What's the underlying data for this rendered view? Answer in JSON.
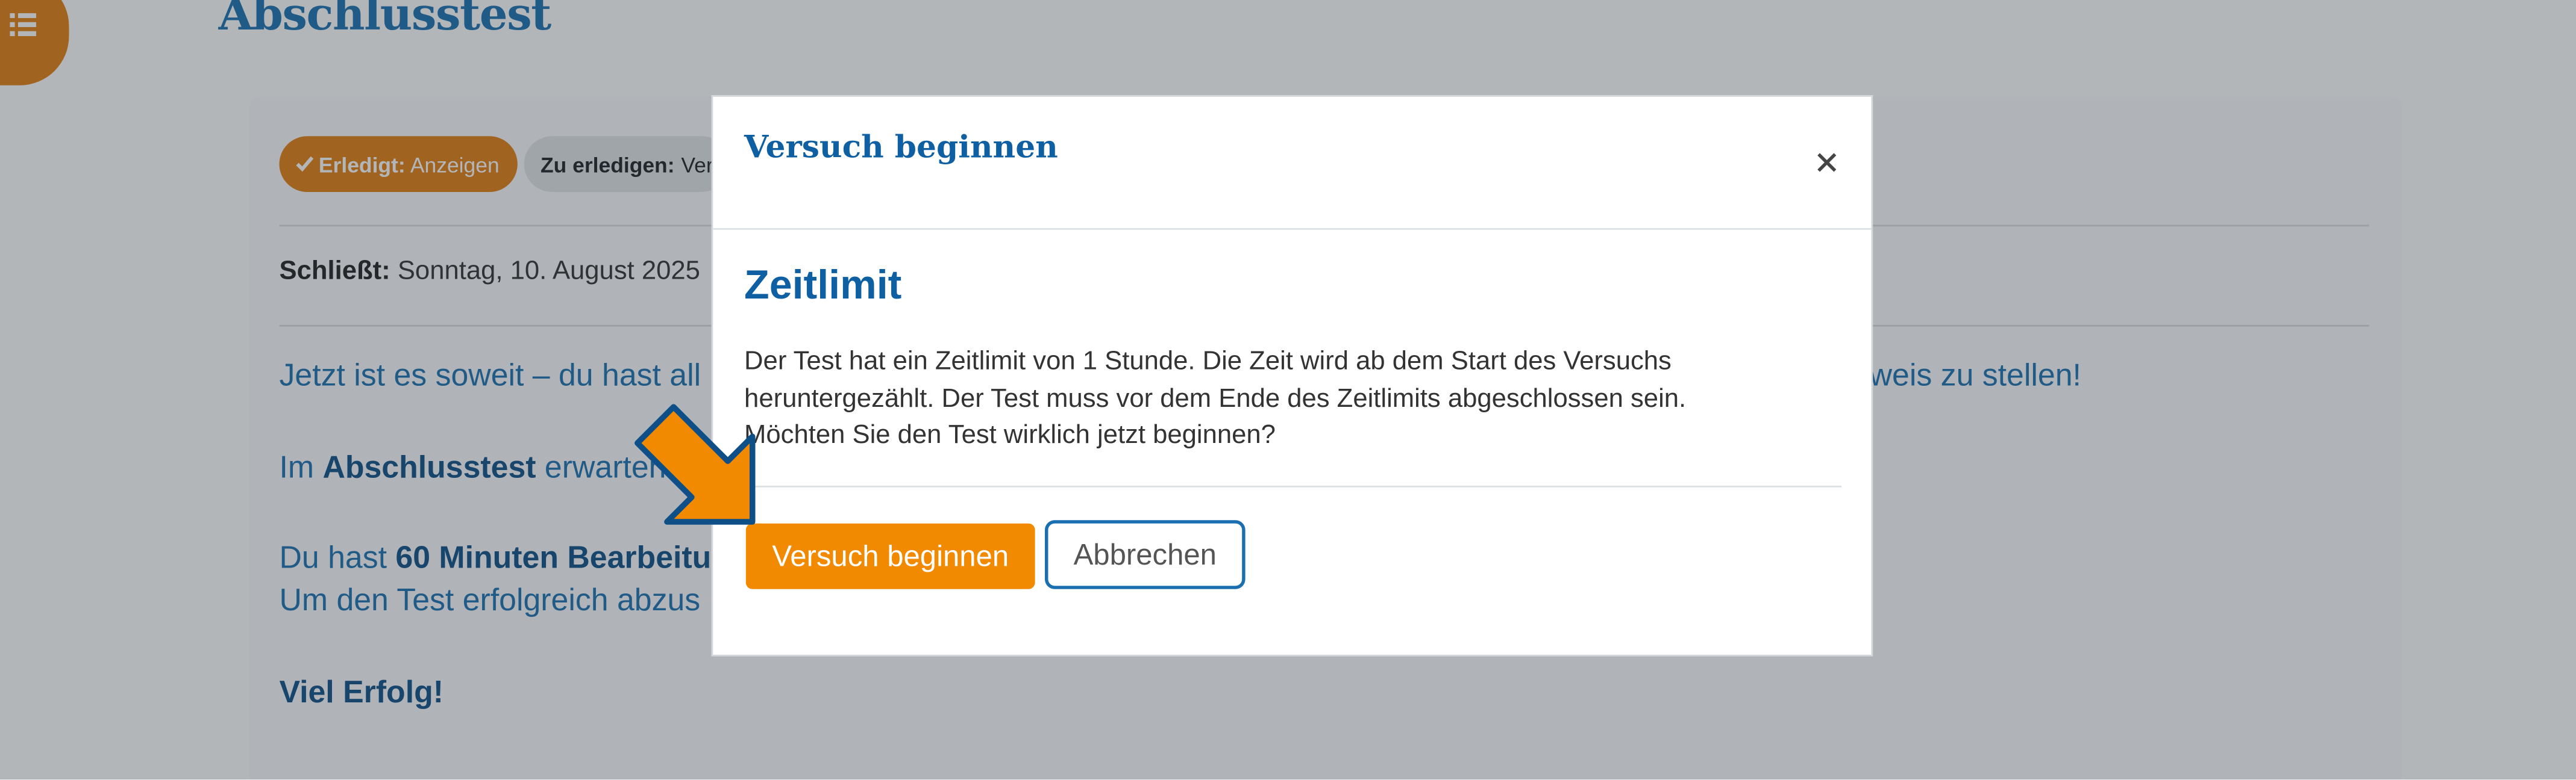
{
  "page": {
    "title": "Abschlusstest",
    "drawer_icon": "list-icon",
    "badges": {
      "done_label": "Erledigt:",
      "done_value": "Anzeigen",
      "done_icon": "check-icon",
      "todo_label": "Zu erledigen:",
      "todo_value": "Ver"
    },
    "closes_label": "Schließt:",
    "closes_value": "Sonntag, 10. August 2025",
    "paragraph1_visible_left": "Jetzt ist es soweit – du hast all",
    "paragraph1_visible_right": "weis zu stellen!",
    "paragraph2_prefix": "Im ",
    "paragraph2_bold": "Abschlusstest",
    "paragraph2_suffix": " erwarten",
    "paragraph3_prefix": "Du hast ",
    "paragraph3_bold": "60 Minuten Bearbeitu",
    "paragraph4": "Um den Test erfolgreich abzus",
    "closing": "Viel Erfolg!"
  },
  "modal": {
    "title": "Versuch beginnen",
    "close_icon": "close-icon",
    "heading": "Zeitlimit",
    "body_line1": "Der Test hat ein Zeitlimit von 1 Stunde. Die Zeit wird ab dem Start des Versuchs",
    "body_line2": "heruntergezählt. Der Test muss vor dem Ende des Zeitlimits abgeschlossen sein.",
    "body_line3": "Möchten Sie den Test wirklich jetzt beginnen?",
    "start_button": "Versuch beginnen",
    "cancel_button": "Abbrechen"
  },
  "annotation": {
    "pointer_icon": "arrow-pointer-icon"
  },
  "colors": {
    "brand_blue": "#1a6fb0",
    "accent_orange": "#f18a00",
    "badge_orange": "#e37d10"
  }
}
